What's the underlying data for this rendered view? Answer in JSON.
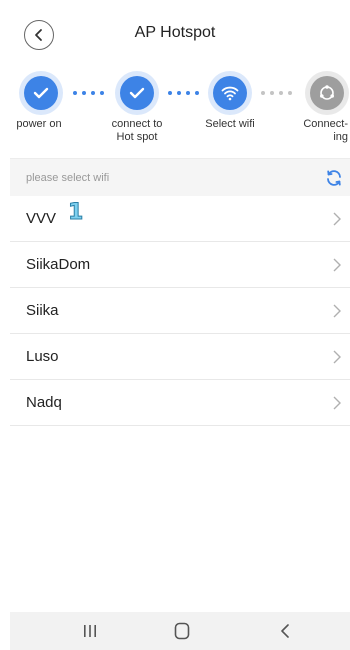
{
  "header": {
    "title": "AP Hotspot"
  },
  "steps": [
    {
      "label": "power on",
      "state": "done",
      "icon": "check-icon"
    },
    {
      "label": "connect to\nHot spot",
      "state": "done",
      "icon": "check-icon"
    },
    {
      "label": "Select wifi",
      "state": "active",
      "icon": "wifi-icon"
    },
    {
      "label": "Connect-\ning",
      "state": "pending",
      "icon": "connecting-icon"
    }
  ],
  "list": {
    "header_label": "please select wifi",
    "items": [
      "VVV",
      "SiikaDom",
      "Siika",
      "Luso",
      "Nadq"
    ],
    "annotation": "1"
  },
  "colors": {
    "accent": "#3d83e6",
    "pending": "#9e9e9e",
    "badge": "#7ed0ef"
  }
}
